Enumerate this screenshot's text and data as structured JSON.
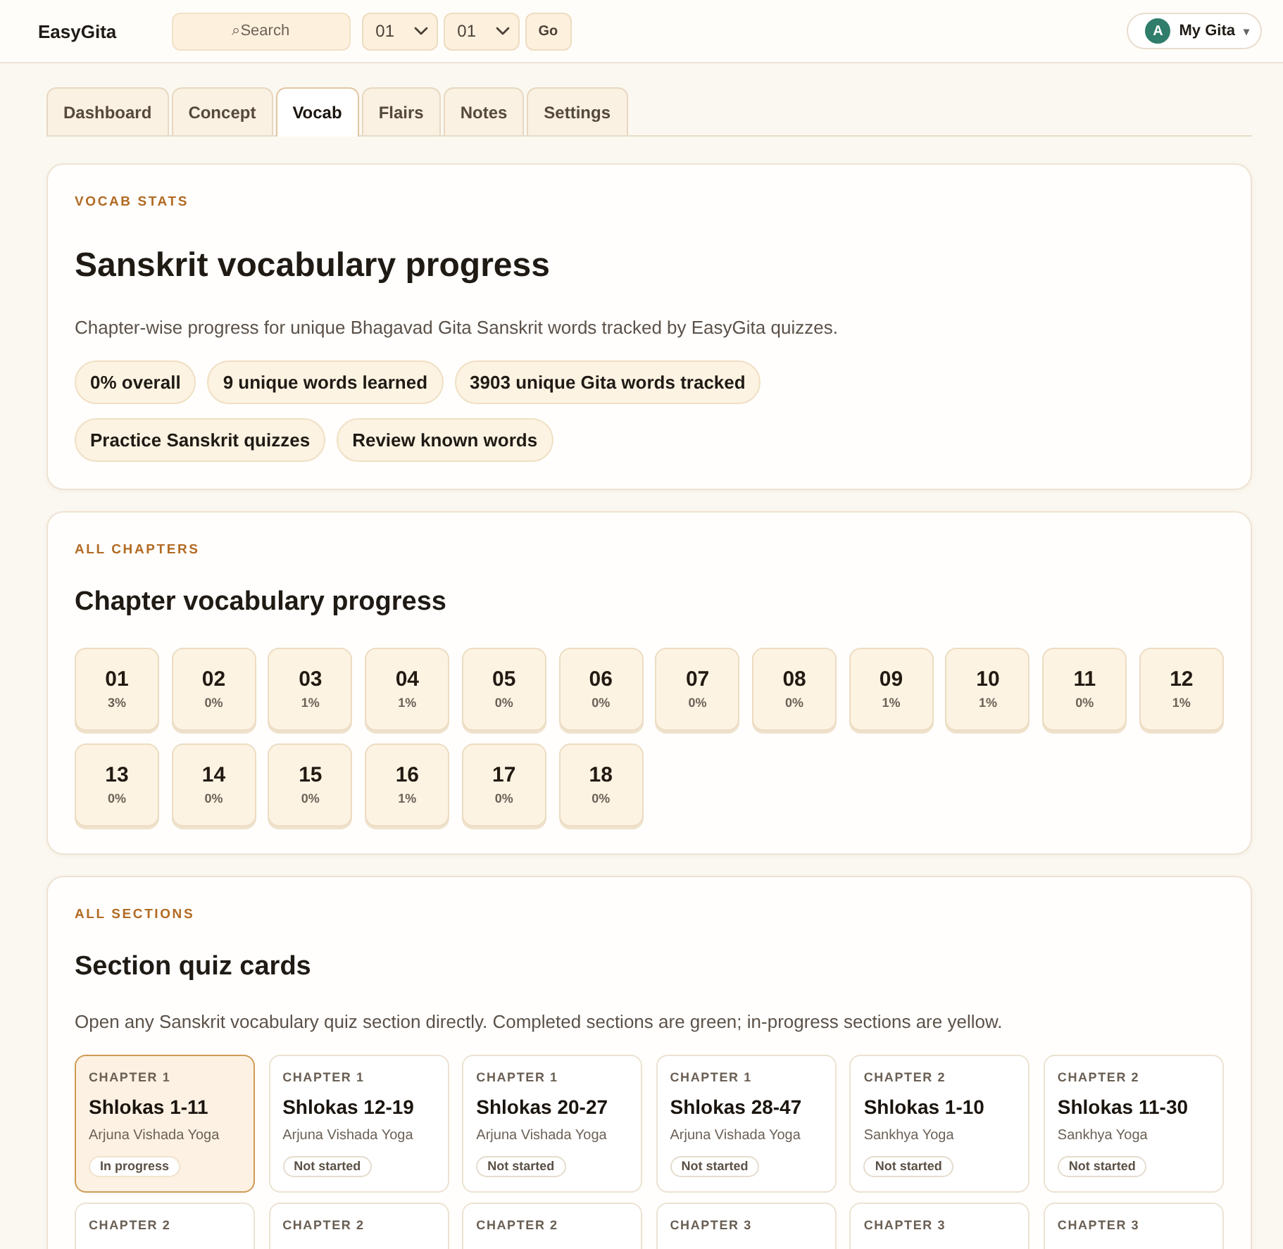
{
  "header": {
    "logo": "EasyGita",
    "search": {
      "placeholder": "⌕Search"
    },
    "dropdowns": [
      {
        "value": "01"
      },
      {
        "value": "01"
      }
    ],
    "go_button": "Go",
    "account": {
      "avatar": "A",
      "label": "My Gita",
      "caret": "▾"
    }
  },
  "tabs": [
    {
      "label": "Dashboard",
      "selected": false
    },
    {
      "label": "Concept",
      "selected": false
    },
    {
      "label": "Vocab",
      "selected": true
    },
    {
      "label": "Flairs",
      "selected": false
    },
    {
      "label": "Notes",
      "selected": false
    },
    {
      "label": "Settings",
      "selected": false
    }
  ],
  "stats": {
    "eyebrow": "VOCAB STATS",
    "title": "Sanskrit vocabulary progress",
    "description": "Chapter-wise progress for unique Bhagavad Gita Sanskrit words tracked by EasyGita quizzes.",
    "stat_chips": [
      "0% overall",
      "9 unique words learned",
      "3903 unique Gita words tracked"
    ],
    "actions": [
      "Practice Sanskrit quizzes",
      "Review known words"
    ]
  },
  "chapters": {
    "eyebrow": "ALL CHAPTERS",
    "title": "Chapter vocabulary progress",
    "tiles": [
      {
        "number": "01",
        "percent": "3%"
      },
      {
        "number": "02",
        "percent": "0%"
      },
      {
        "number": "03",
        "percent": "1%"
      },
      {
        "number": "04",
        "percent": "1%"
      },
      {
        "number": "05",
        "percent": "0%"
      },
      {
        "number": "06",
        "percent": "0%"
      },
      {
        "number": "07",
        "percent": "0%"
      },
      {
        "number": "08",
        "percent": "0%"
      },
      {
        "number": "09",
        "percent": "1%"
      },
      {
        "number": "10",
        "percent": "1%"
      },
      {
        "number": "11",
        "percent": "0%"
      },
      {
        "number": "12",
        "percent": "1%"
      },
      {
        "number": "13",
        "percent": "0%"
      },
      {
        "number": "14",
        "percent": "0%"
      },
      {
        "number": "15",
        "percent": "0%"
      },
      {
        "number": "16",
        "percent": "1%"
      },
      {
        "number": "17",
        "percent": "0%"
      },
      {
        "number": "18",
        "percent": "0%"
      }
    ]
  },
  "sections": {
    "eyebrow": "ALL SECTIONS",
    "title": "Section quiz cards",
    "description": "Open any Sanskrit vocabulary quiz section directly. Completed sections are green; in-progress sections are yellow.",
    "cards": [
      {
        "chapter": "CHAPTER 1",
        "title": "Shlokas 1-11",
        "subtitle": "Arjuna Vishada Yoga",
        "kind": "progress",
        "badge": "In progress"
      },
      {
        "chapter": "CHAPTER 1",
        "title": "Shlokas 12-19",
        "subtitle": "Arjuna Vishada Yoga",
        "kind": "idle",
        "badge": "Not started"
      },
      {
        "chapter": "CHAPTER 1",
        "title": "Shlokas 20-27",
        "subtitle": "Arjuna Vishada Yoga",
        "kind": "idle",
        "badge": "Not started"
      },
      {
        "chapter": "CHAPTER 1",
        "title": "Shlokas 28-47",
        "subtitle": "Arjuna Vishada Yoga",
        "kind": "idle",
        "badge": "Not started"
      },
      {
        "chapter": "CHAPTER 2",
        "title": "Shlokas 1-10",
        "subtitle": "Sankhya Yoga",
        "kind": "idle",
        "badge": "Not started"
      },
      {
        "chapter": "CHAPTER 2",
        "title": "Shlokas 11-30",
        "subtitle": "Sankhya Yoga",
        "kind": "idle",
        "badge": "Not started"
      },
      {
        "chapter": "CHAPTER 2"
      },
      {
        "chapter": "CHAPTER 2"
      },
      {
        "chapter": "CHAPTER 2"
      },
      {
        "chapter": "CHAPTER 3"
      },
      {
        "chapter": "CHAPTER 3"
      },
      {
        "chapter": "CHAPTER 3"
      }
    ]
  }
}
